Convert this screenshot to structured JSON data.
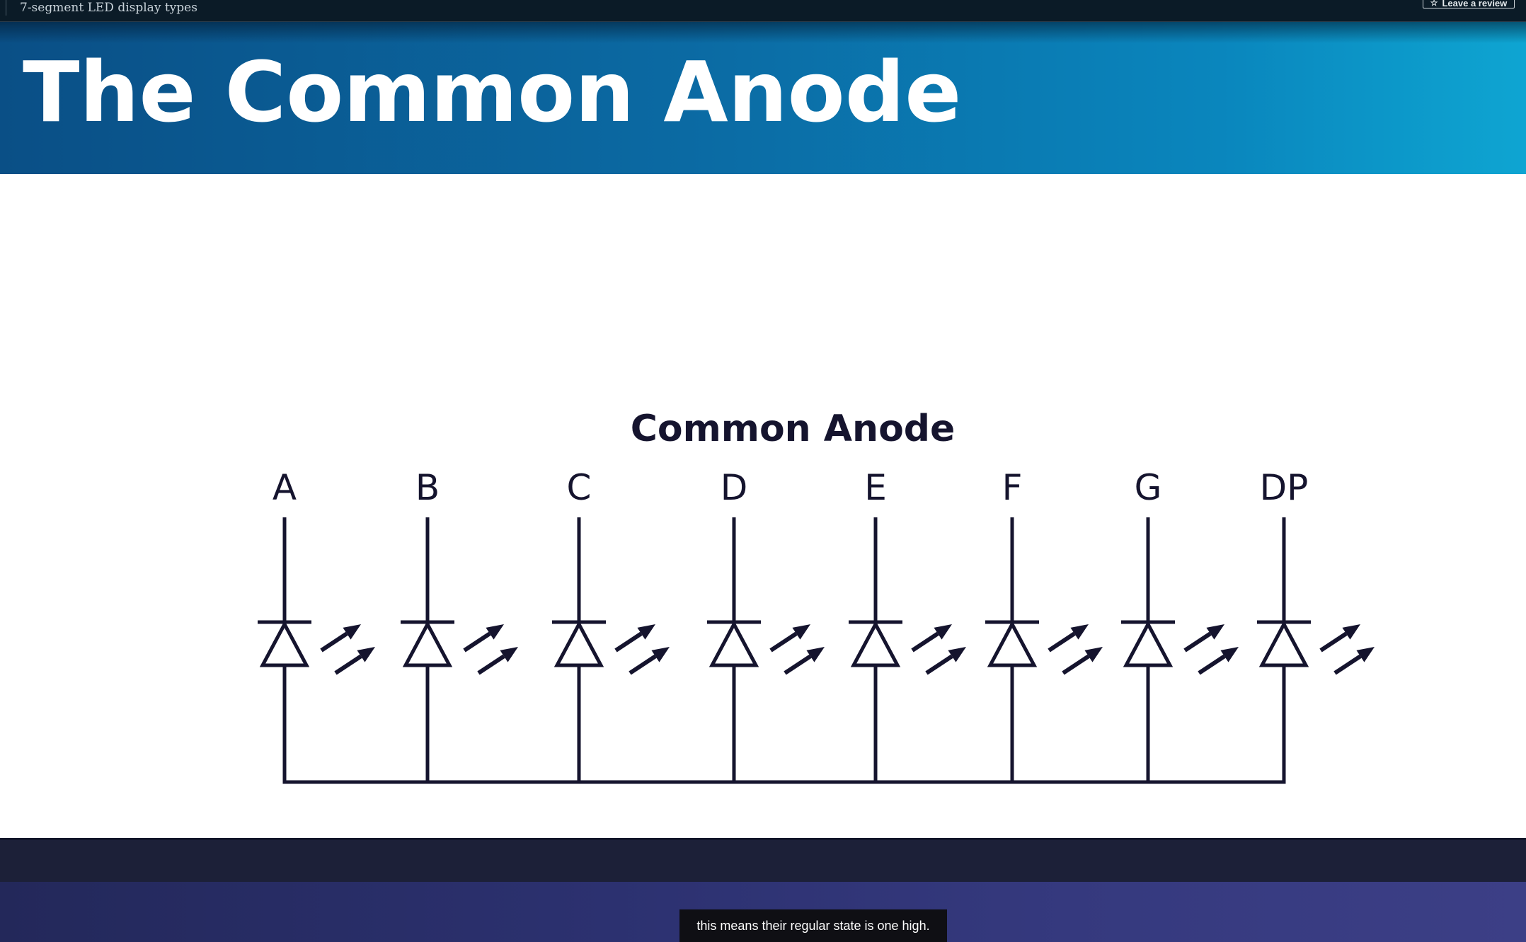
{
  "topbar": {
    "course_title": "7-segment LED display types",
    "review_button_label": "Leave a review",
    "review_icon": "star-outline-icon"
  },
  "slide": {
    "title": "The Common Anode",
    "diagram": {
      "title": "Common Anode",
      "pins": [
        "A",
        "B",
        "C",
        "D",
        "E",
        "F",
        "G",
        "DP"
      ],
      "line_color": "#15142e"
    },
    "header_color": "#0b6aa3"
  },
  "player": {
    "caption": "this means their regular state is one high."
  }
}
